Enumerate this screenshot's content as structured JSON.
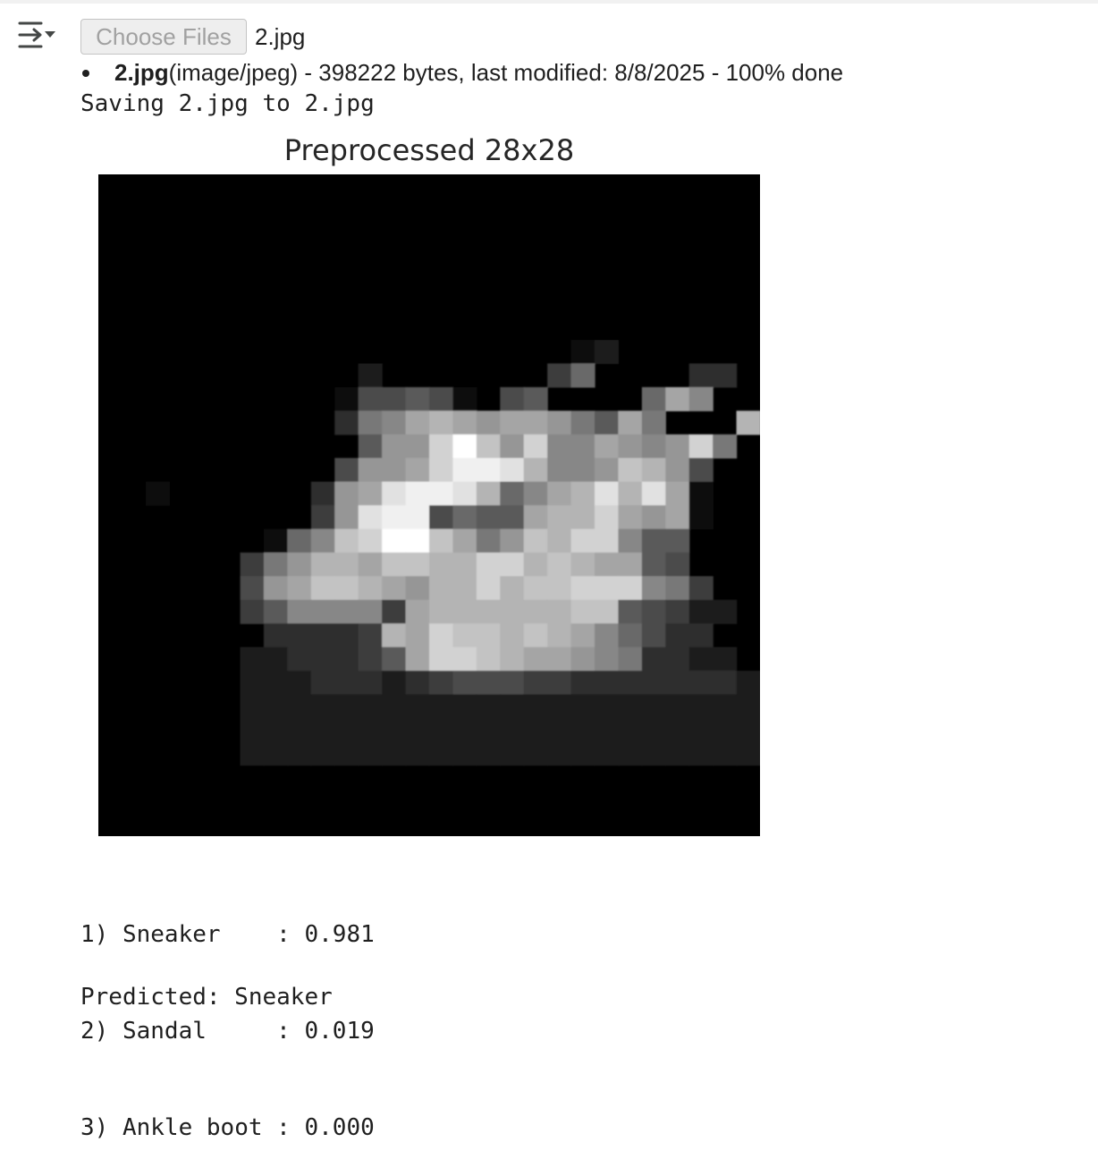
{
  "upload_widget": {
    "button_label": "Choose Files",
    "chosen_file": "2.jpg",
    "uploaded": {
      "name": "2.jpg",
      "details": "(image/jpeg) - 398222 bytes, last modified: 8/8/2025 - 100% done"
    }
  },
  "output": {
    "saving_line": "Saving 2.jpg to 2.jpg",
    "plot_title": "Preprocessed 28x28",
    "predictions": [
      {
        "rank": "1)",
        "label": "Sneaker   ",
        "score": "0.981"
      },
      {
        "rank": "2)",
        "label": "Sandal    ",
        "score": "0.019"
      },
      {
        "rank": "3)",
        "label": "Ankle boot",
        "score": "0.000"
      }
    ],
    "predicted_line": "Predicted: Sneaker"
  },
  "icons": {
    "output_toggle": "output-toggle-icon"
  },
  "preprocessed_image": {
    "size": 28,
    "pixels": [
      "............................",
      "............................",
      "............................",
      "............................",
      "............................",
      "............................",
      "............................",
      "....................12......",
      "...........2.......47....33.",
      "..........155651.56....7B9..",
      "..........389BCBABBA86B8...",
      "...........6AAEHDAE99BA9AE8..",
      "..........5AABEGGFC99ADCA5..",
      "..1......3ABFGGFC79BCFCFB1...",
      ".........4AFGG5766BCCEBAB1..",
      ".......179DEHHDB8AD EE966...",
      "......48ACCBDDCCEECDCBB65...",
      "......5ABDDCBACCECDDEEE984..",
      "......4699994BCCC CCDD65422..",
      ".......33334CBEDDCDCB97533...",
      "......2233346BEEDCBBA983322..",
      "......2223332345554433333332.",
      "......2222222222222222222222.",
      "......2222222222222222222222.",
      "......2222222222222222222222.",
      "............................",
      "............................",
      "............................"
    ]
  }
}
